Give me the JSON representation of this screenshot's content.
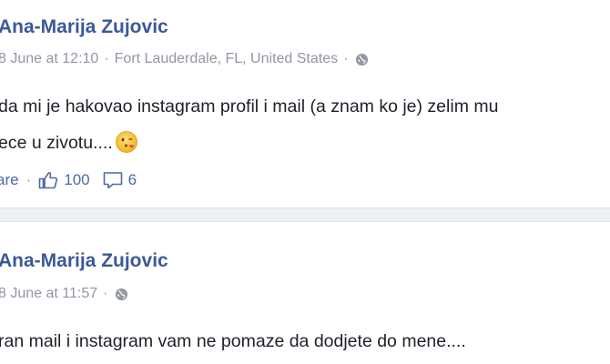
{
  "posts": [
    {
      "author": "Ana-Marija Zujovic",
      "date": "8 June at 12:10",
      "location": "Fort Lauderdale, FL, United States",
      "separator": "·",
      "text_line1": "da mi je hakovao instagram profil i mail (a znam ko je) zelim mu",
      "text_line2": "ece u zivotu....",
      "share_label": "are",
      "likes": "100",
      "comments": "6"
    },
    {
      "author": "Ana-Marija Zujovic",
      "date": "8 June at 11:57",
      "separator": "·",
      "text_line1": "ran mail i instagram vam ne pomaze da dodjete do mene...."
    }
  ],
  "icons": {
    "globe": "globe-icon",
    "like": "thumbs-up-icon",
    "comment": "comment-bubble-icon",
    "emoji": "kissing-wink-emoji"
  },
  "colors": {
    "author": "#3b5998",
    "meta": "#9197a3",
    "text": "#1d2129",
    "action": "#4b6aa8"
  }
}
